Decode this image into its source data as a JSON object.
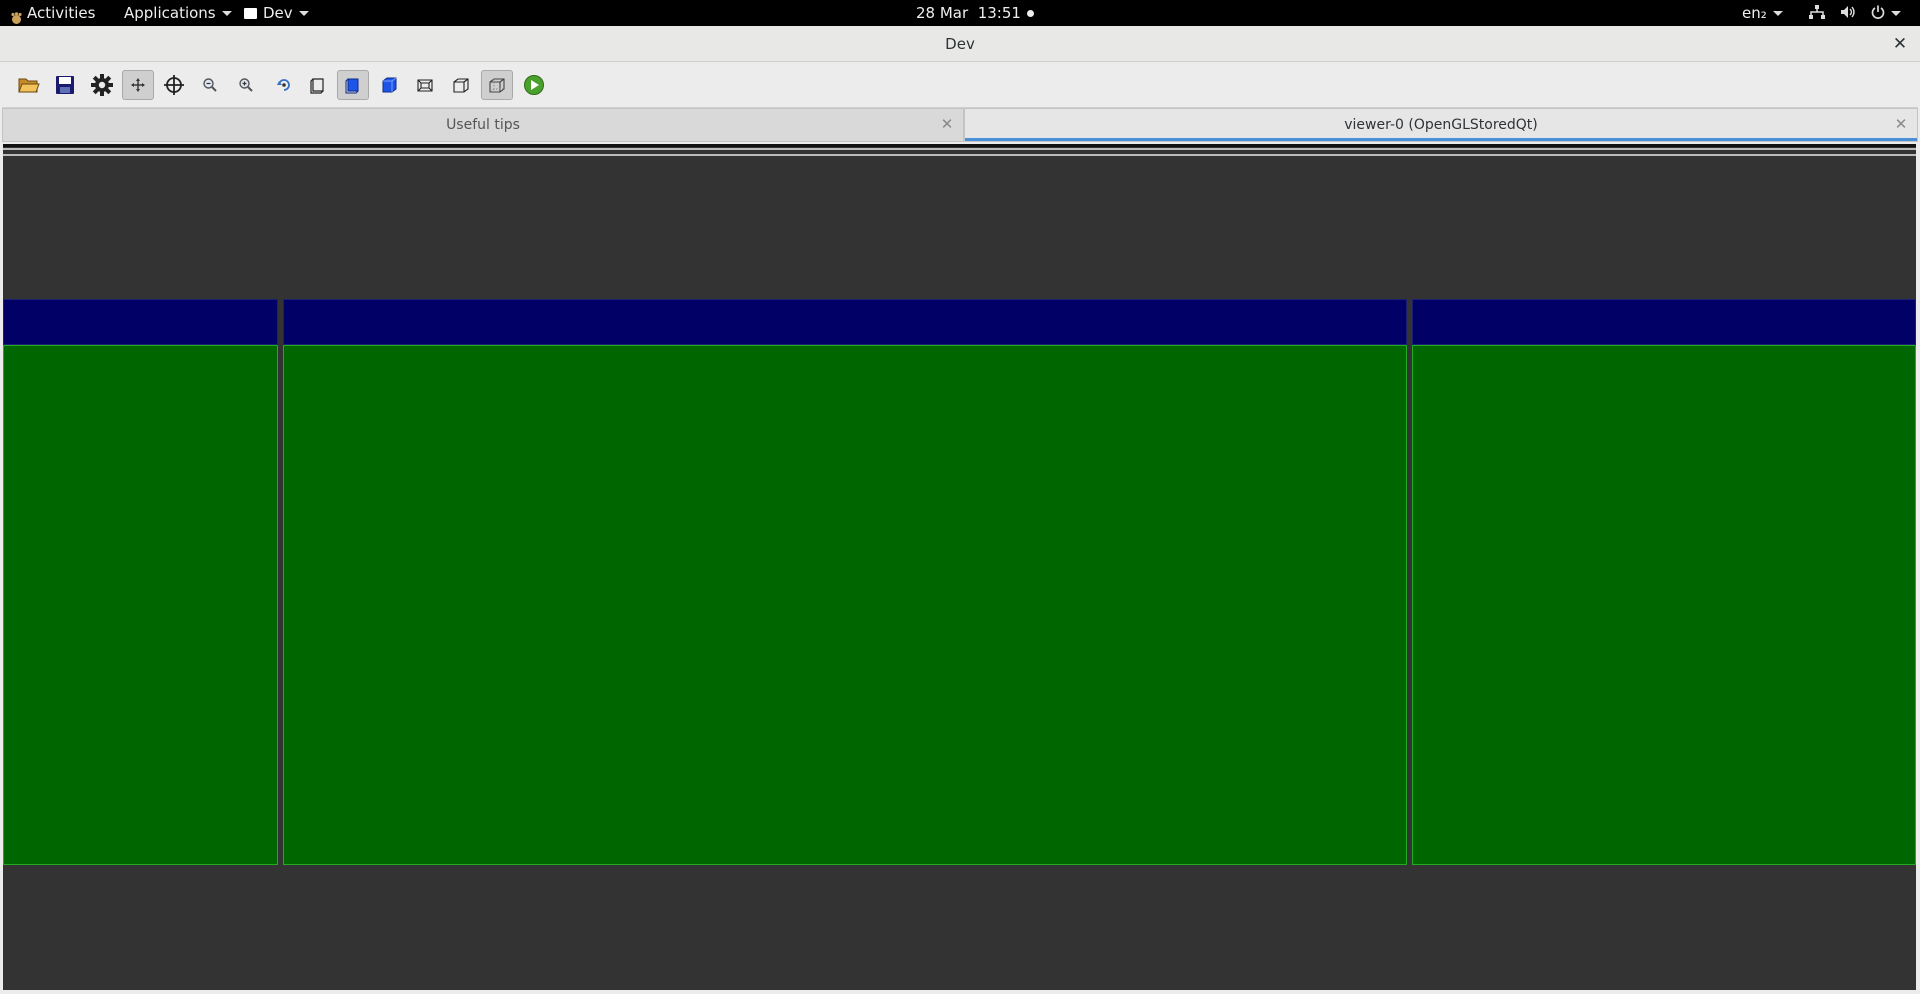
{
  "topbar": {
    "activities": "Activities",
    "applications": "Applications",
    "app_menu": "Dev",
    "clock": "28 Mar  13:51",
    "input_source": "en₂"
  },
  "window": {
    "title": "Dev",
    "close_glyph": "✕"
  },
  "toolbar": {
    "tools": [
      {
        "name": "open-file",
        "icon": "folder-open-icon",
        "active": false
      },
      {
        "name": "save",
        "icon": "floppy-disk-icon",
        "active": false
      },
      {
        "name": "settings",
        "icon": "gear-icon",
        "active": false
      },
      {
        "name": "pan",
        "icon": "move-arrows-icon",
        "active": true
      },
      {
        "name": "center",
        "icon": "crosshair-icon",
        "active": false
      },
      {
        "name": "zoom-out",
        "icon": "zoom-out-icon",
        "active": false
      },
      {
        "name": "zoom-in",
        "icon": "zoom-in-icon",
        "active": false
      },
      {
        "name": "rotate",
        "icon": "rotate-icon",
        "active": false
      },
      {
        "name": "wireframe-view",
        "icon": "wireframe-square-icon",
        "active": false
      },
      {
        "name": "solid-view",
        "icon": "solid-square-icon",
        "active": true
      },
      {
        "name": "solid-3d-view",
        "icon": "solid-cube-icon",
        "active": false
      },
      {
        "name": "perspective-view",
        "icon": "perspective-box-icon",
        "active": false
      },
      {
        "name": "ortho-view",
        "icon": "ortho-box-icon",
        "active": false
      },
      {
        "name": "box-view",
        "icon": "hidden-line-box-icon",
        "active": true
      },
      {
        "name": "run",
        "icon": "play-icon",
        "active": false
      }
    ]
  },
  "tabs": [
    {
      "label": "Useful tips",
      "close": "✕",
      "current": false
    },
    {
      "label": "viewer-0 (OpenGLStoredQt)",
      "close": "✕",
      "current": true
    }
  ],
  "viewer": {
    "background_color": "#333333",
    "header_color": "#000066",
    "body_color": "#006600",
    "panels": [
      "left-panel",
      "center-panel",
      "right-panel"
    ]
  }
}
